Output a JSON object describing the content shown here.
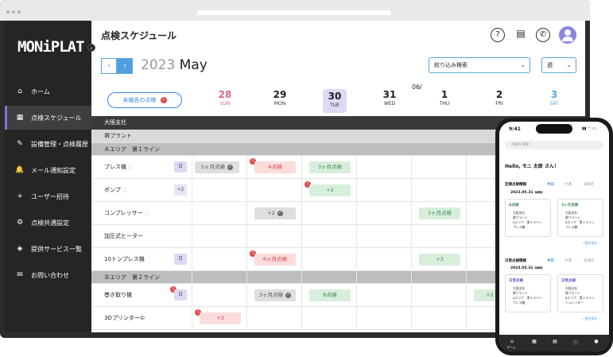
{
  "app": {
    "logo": "MONiPLAT",
    "page_title": "点検スケジュール"
  },
  "sidebar": {
    "collapse_icon": "chevron-left-icon",
    "items": [
      {
        "label": "ホーム",
        "icon": "⌂"
      },
      {
        "label": "点検スケジュール",
        "icon": "▦"
      },
      {
        "label": "設備管理・点検履歴",
        "icon": "✎"
      },
      {
        "label": "メール通知設定",
        "icon": "🔔"
      },
      {
        "label": "ユーザー招待",
        "icon": "+"
      },
      {
        "label": "点検共通設定",
        "icon": "⚙"
      },
      {
        "label": "提供サービス一覧",
        "icon": "◈"
      },
      {
        "label": "お問い合わせ",
        "icon": "✉"
      }
    ]
  },
  "header": {
    "help": "?",
    "doc": "▤",
    "announce": "✆"
  },
  "calendar": {
    "prev": "‹",
    "next": "›",
    "year": "2023",
    "month": "May",
    "filter_label": "絞り込み検索",
    "view_label": "週",
    "unreported_label": "未報告の点検",
    "unreported_badge": "!",
    "week_label": "06/",
    "days": [
      {
        "num": "28",
        "wd": "SUN"
      },
      {
        "num": "29",
        "wd": "MON"
      },
      {
        "num": "30",
        "wd": "TUE"
      },
      {
        "num": "31",
        "wd": "WED"
      },
      {
        "num": "1",
        "wd": "THU"
      },
      {
        "num": "2",
        "wd": "FRI"
      },
      {
        "num": "3",
        "wd": "SAT"
      }
    ]
  },
  "groups": {
    "office": "大阪支社",
    "plant": "堺プラント",
    "area_a": "Ａエリア　第１ライン",
    "area_b": "Ｂエリア　第２ライン"
  },
  "equipment": [
    {
      "name": "プレス機",
      "tag": "日"
    },
    {
      "name": "ポンプ",
      "tag": "+2"
    },
    {
      "name": "コンプレッサー",
      "tag": ""
    },
    {
      "name": "加圧式ヒーター",
      "tag": ""
    },
    {
      "name": "10トンプレス機",
      "tag": "日"
    },
    {
      "name": "巻き取り機",
      "tag": "日"
    },
    {
      "name": "3Dプリンター①",
      "tag": ""
    }
  ],
  "chips": {
    "press_6m": "5ヶ月点検",
    "press_a": "A点検",
    "press_3m": "3ヶ月点検",
    "pump_plus": "+2",
    "comp_plus": "+2",
    "comp_3m": "3ヶ月点検",
    "ten_6m": "6ヶ月点検",
    "ten_plus": "+3",
    "roll_3m": "3ヶ月点検",
    "roll_b": "B点検",
    "roll_plus": "+2",
    "p3d_plus": "+3",
    "alert": "!",
    "done": "✓"
  },
  "phone": {
    "time": "9:41",
    "status": "▮▮ ◠ ▭",
    "search": "点検を検索",
    "greeting": "Hello, モニ 太郎 さん！",
    "sec1": "定期点検情報",
    "sec2": "日常点検情報",
    "tab_today": "今日",
    "tab_tomorrow": "今週",
    "tab_unreported": "未報告",
    "date": "2023.05.31",
    "date_wd": "WED",
    "card1_title": "A点検",
    "card2_title": "3ヶ月点検",
    "card3_title": "日常点検",
    "card4_title": "日常点検",
    "line_office": "大阪支社",
    "line_plant": "堺プラント",
    "line_area_a": "Aエリア　第１ライン",
    "line_area_b": "Bエリア　第１ライン",
    "line_eq1": "プレス機",
    "line_eq2": "シュレッダー",
    "more": "一覧を見る ›",
    "nav_home": "ホーム"
  }
}
